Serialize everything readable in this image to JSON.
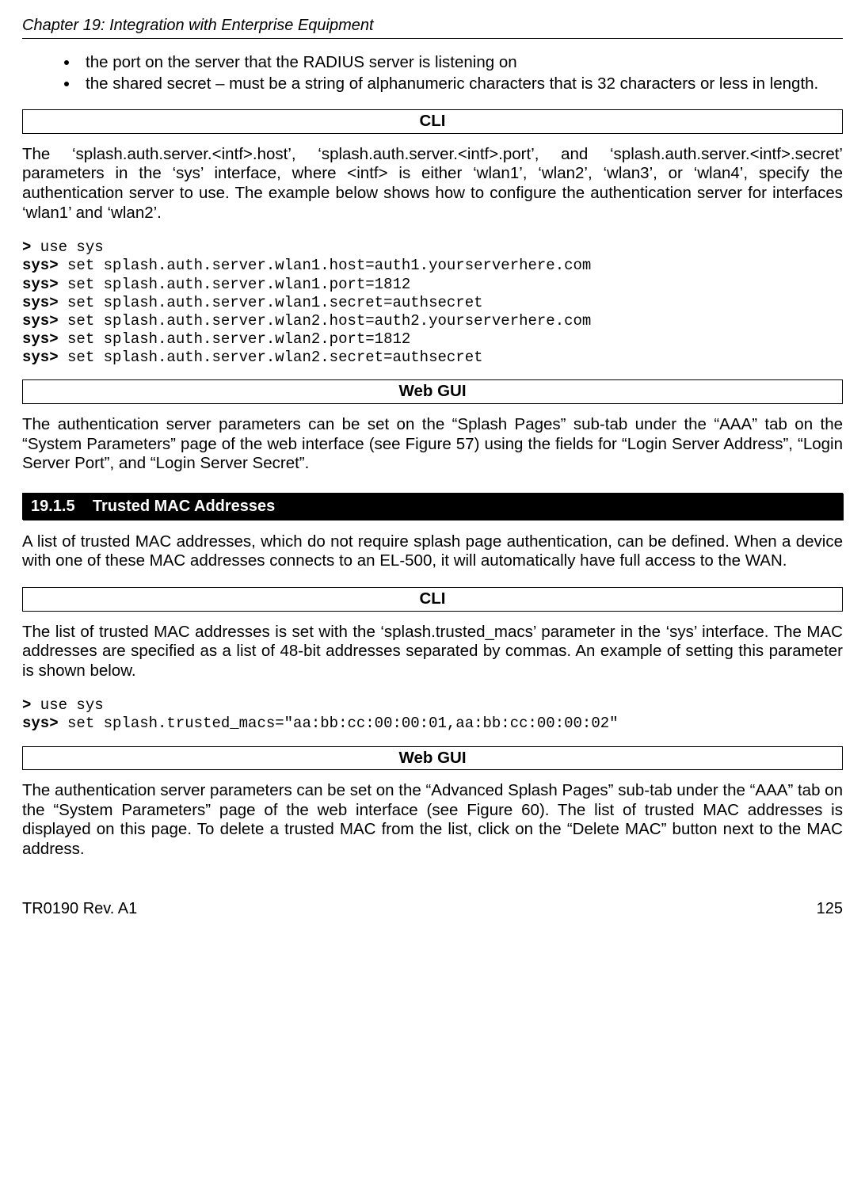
{
  "header": {
    "chapter": "Chapter 19: Integration with Enterprise Equipment"
  },
  "bullets": {
    "b1": "the port on the server that the RADIUS server is listening on",
    "b2": "the shared secret – must be a string of alphanumeric characters that is 32 characters or less in length."
  },
  "labels": {
    "cli": "CLI",
    "webgui": "Web GUI"
  },
  "para1": "The ‘splash.auth.server.<intf>.host’, ‘splash.auth.server.<intf>.port’, and ‘splash.auth.server.<intf>.secret’ parameters in the ‘sys’ interface, where <intf> is either ‘wlan1’, ‘wlan2’, ‘wlan3’, or ‘wlan4’, specify the authentication server to use. The example below shows how to configure the authentication server for interfaces ‘wlan1’ and ‘wlan2’.",
  "cli1": {
    "p0a": ">",
    "l0": " use sys",
    "p1a": "sys>",
    "l1": " set splash.auth.server.wlan1.host=auth1.yourserverhere.com",
    "p2a": "sys>",
    "l2": " set splash.auth.server.wlan1.port=1812",
    "p3a": "sys>",
    "l3": " set splash.auth.server.wlan1.secret=authsecret",
    "p4a": "sys>",
    "l4": " set splash.auth.server.wlan2.host=auth2.yourserverhere.com",
    "p5a": "sys>",
    "l5": " set splash.auth.server.wlan2.port=1812",
    "p6a": "sys>",
    "l6": " set splash.auth.server.wlan2.secret=authsecret"
  },
  "para2": "The authentication server parameters can be set on the “Splash Pages” sub-tab under the “AAA” tab on the “System Parameters” page of the web interface (see Figure 57) using the fields for “Login Server Address”, “Login Server Port”, and “Login Server Secret”.",
  "section": {
    "num": "19.1.5",
    "title": "Trusted MAC Addresses"
  },
  "para3": "A list of trusted MAC addresses, which do not require splash page authentication, can be defined. When a device with one of these MAC addresses connects to an EL-500, it will automatically have full access to the WAN.",
  "para4": "The list of trusted MAC addresses is set with the ‘splash.trusted_macs’ parameter in the ‘sys’ interface. The MAC addresses are specified as a list of 48-bit addresses separated by commas. An example of setting this parameter is shown below.",
  "cli2": {
    "p0a": ">",
    "l0": " use sys",
    "p1a": "sys>",
    "l1": " set splash.trusted_macs=\"aa:bb:cc:00:00:01,aa:bb:cc:00:00:02\""
  },
  "para5": "The authentication server parameters can be set on the “Advanced Splash Pages” sub-tab under the “AAA” tab on the “System Parameters” page of the web interface (see Figure 60). The list of trusted MAC addresses is displayed on this page. To delete a trusted MAC from the list, click on the “Delete MAC” button next to the MAC address.",
  "footer": {
    "left": "TR0190 Rev. A1",
    "right": "125"
  }
}
